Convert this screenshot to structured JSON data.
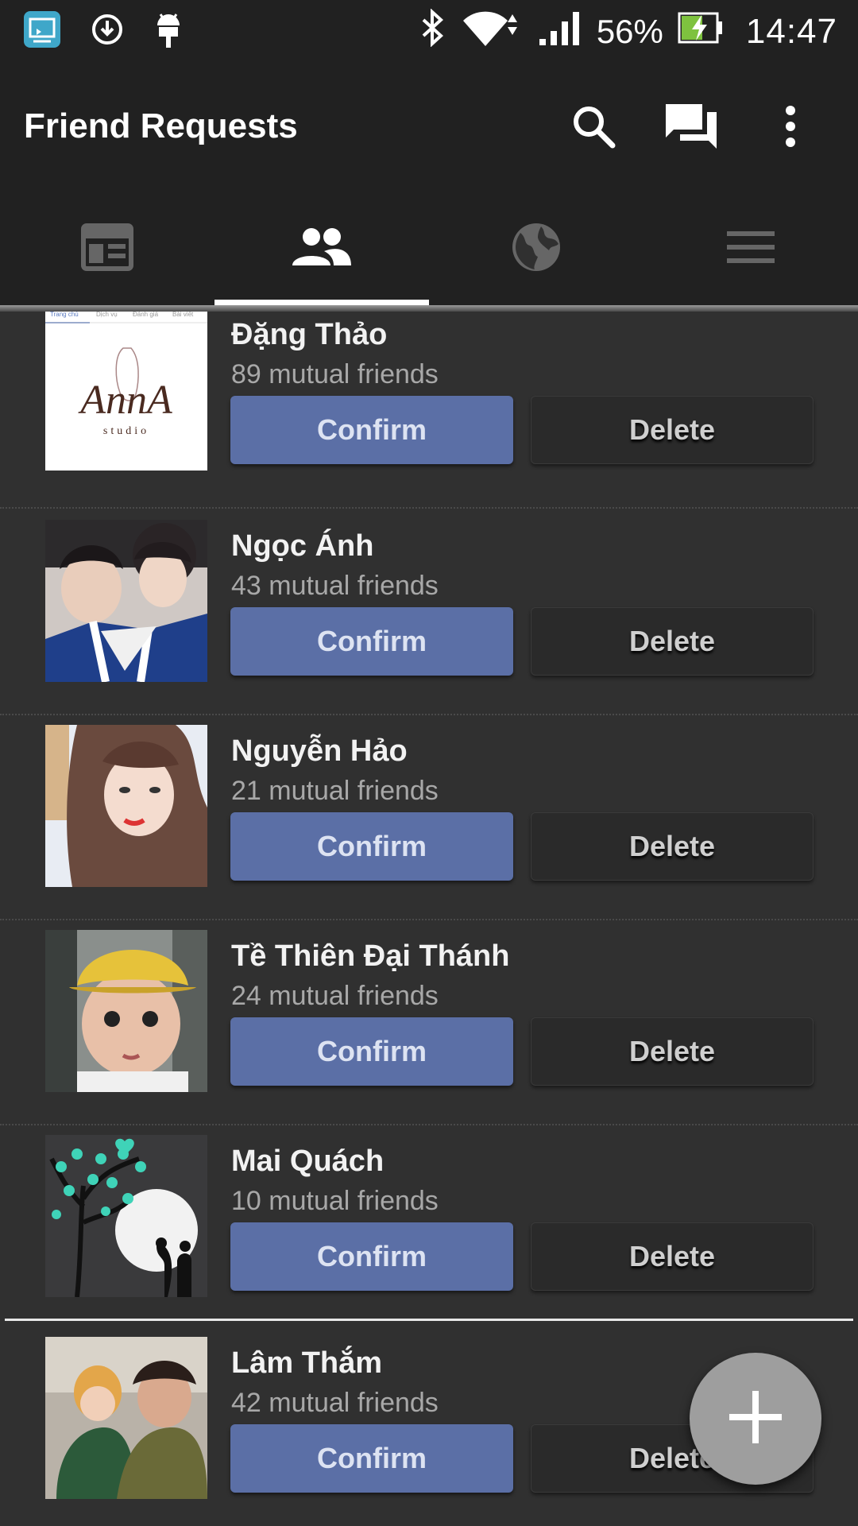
{
  "status_bar": {
    "battery": "56%",
    "time": "14:47"
  },
  "toolbar": {
    "title": "Friend Requests"
  },
  "tabs": [
    {
      "name": "news-feed-tab",
      "icon": "newsfeed-icon",
      "active": false
    },
    {
      "name": "friends-tab",
      "icon": "friends-icon",
      "active": true
    },
    {
      "name": "notifications-tab",
      "icon": "globe-icon",
      "active": false
    },
    {
      "name": "menu-tab",
      "icon": "menu-icon",
      "active": false
    }
  ],
  "requests": [
    {
      "name": "Đặng Thảo",
      "mutual": "89 mutual friends",
      "confirm": "Confirm",
      "delete": "Delete",
      "avatar_text": "AnnA",
      "avatar_sub": "studio",
      "avatar_tabs": [
        "Trang chủ",
        "Dịch vụ",
        "Đánh giá",
        "Bài viết"
      ]
    },
    {
      "name": "Ngọc Ánh",
      "mutual": "43 mutual friends",
      "confirm": "Confirm",
      "delete": "Delete"
    },
    {
      "name": "Nguyễn Hảo",
      "mutual": "21 mutual friends",
      "confirm": "Confirm",
      "delete": "Delete"
    },
    {
      "name": "Tề Thiên Đại Thánh",
      "mutual": "24 mutual friends",
      "confirm": "Confirm",
      "delete": "Delete"
    },
    {
      "name": "Mai Quách",
      "mutual": "10 mutual friends",
      "confirm": "Confirm",
      "delete": "Delete"
    },
    {
      "name": "Lâm Thắm",
      "mutual": "42 mutual friends",
      "confirm": "Confirm",
      "delete": "Delete"
    }
  ],
  "colors": {
    "confirm_bg": "#5b6fa6",
    "bar_bg": "#212121",
    "list_bg": "#303030"
  }
}
